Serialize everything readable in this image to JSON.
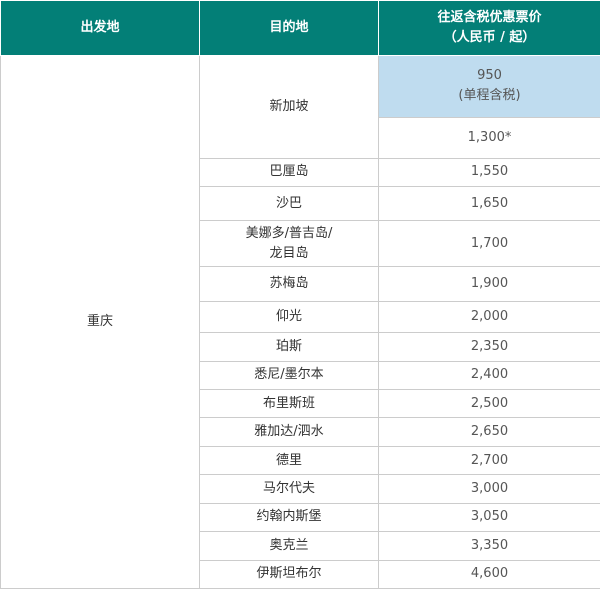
{
  "header": {
    "origin": "出发地",
    "destination": "目的地",
    "price_line1": "往返含税优惠票价",
    "price_line2": "（人民币 / 起）"
  },
  "origin_city": "重庆",
  "singapore": {
    "destination": "新加坡",
    "price_oneway": "950",
    "price_oneway_note": "(单程含税)",
    "price_return": "1,300*"
  },
  "rows": [
    {
      "destination": "巴厘岛",
      "price": "1,550"
    },
    {
      "destination": "沙巴",
      "price": "1,650"
    },
    {
      "destination": "美娜多/普吉岛/\n龙目岛",
      "price": "1,700"
    },
    {
      "destination": "苏梅岛",
      "price": "1,900"
    },
    {
      "destination": "仰光",
      "price": "2,000"
    },
    {
      "destination": "珀斯",
      "price": "2,350"
    },
    {
      "destination": "悉尼/墨尔本",
      "price": "2,400"
    },
    {
      "destination": "布里斯班",
      "price": "2,500"
    },
    {
      "destination": "雅加达/泗水",
      "price": "2,650"
    },
    {
      "destination": "德里",
      "price": "2,700"
    },
    {
      "destination": "马尔代夫",
      "price": "3,000"
    },
    {
      "destination": "约翰内斯堡",
      "price": "3,050"
    },
    {
      "destination": "奥克兰",
      "price": "3,350"
    },
    {
      "destination": "伊斯坦布尔",
      "price": "4,600"
    }
  ],
  "colors": {
    "header_bg": "#037f77",
    "highlight_bg": "#bfdcef"
  }
}
